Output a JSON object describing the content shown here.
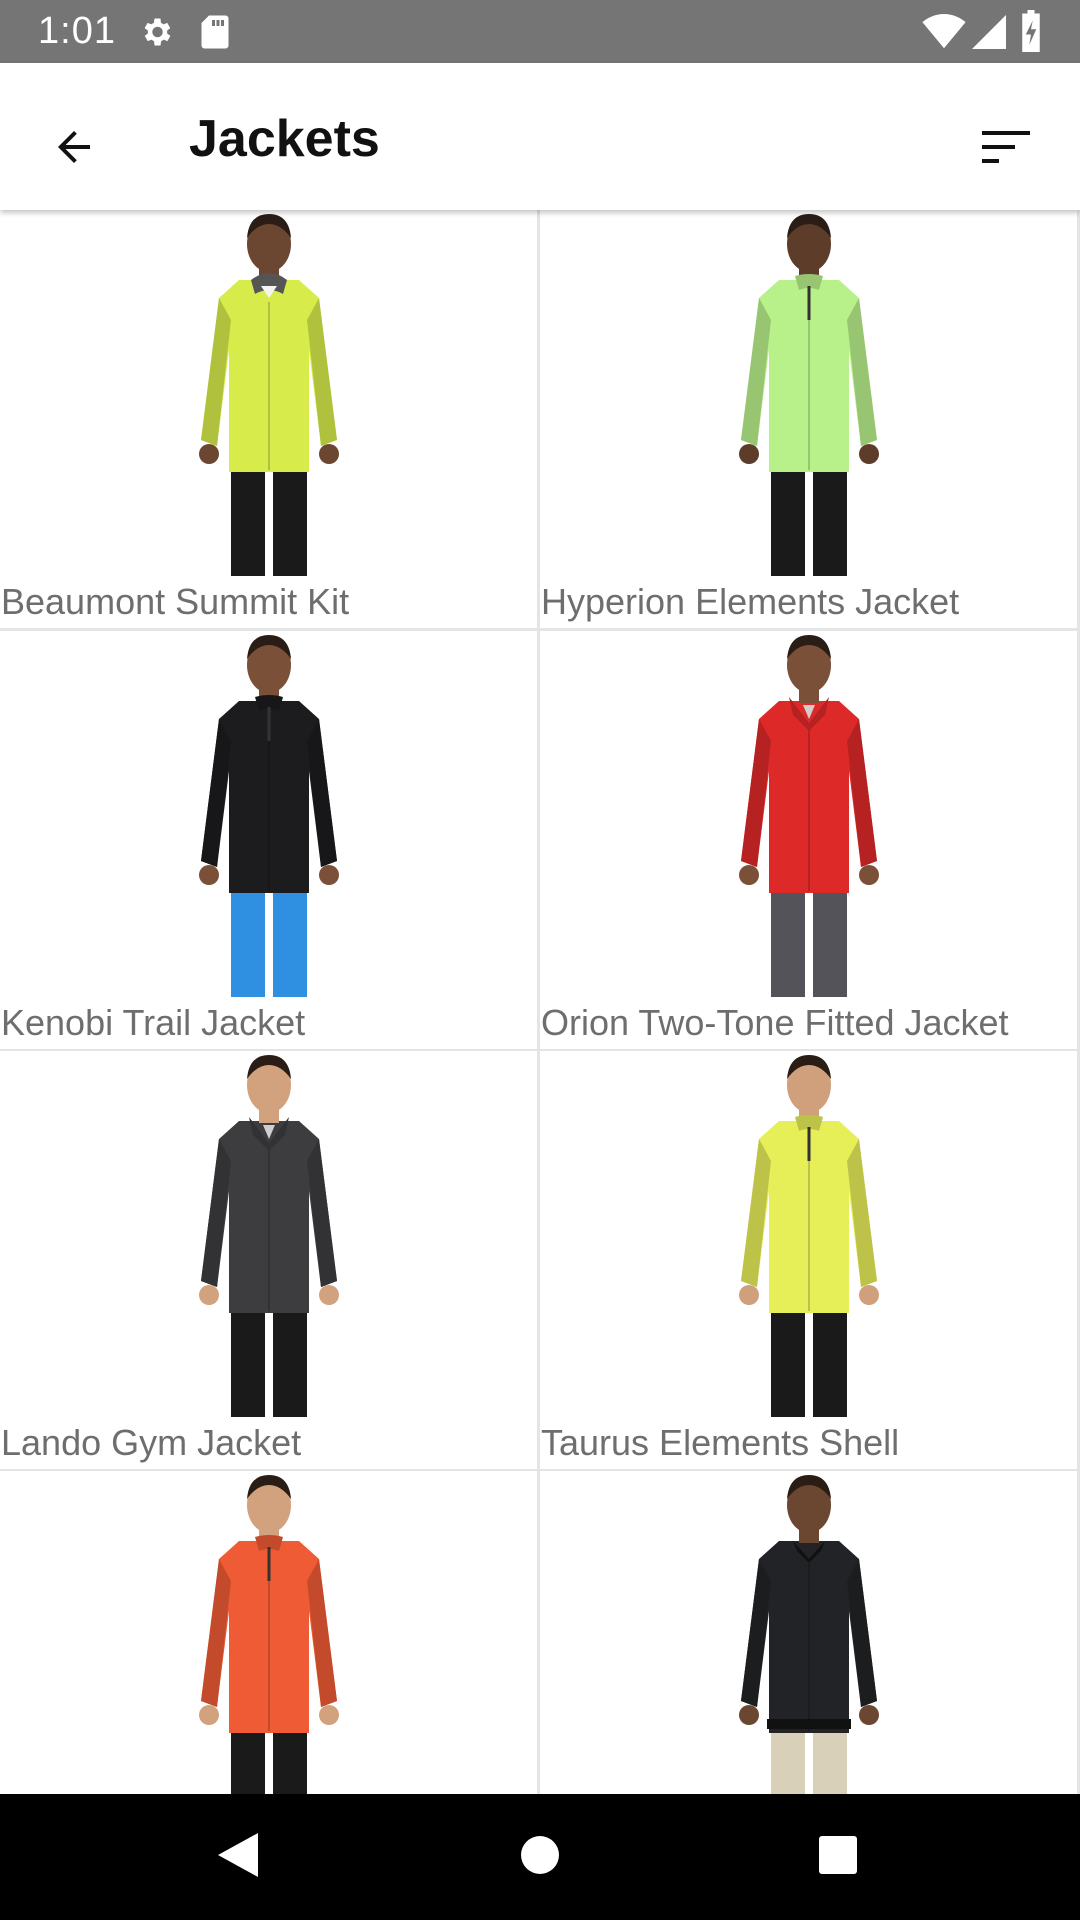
{
  "status_bar": {
    "time": "1:01",
    "icons": [
      "gear-icon",
      "sd-card-icon",
      "wifi-icon",
      "signal-icon",
      "battery-charging-icon"
    ]
  },
  "app_bar": {
    "title": "Jackets",
    "back_icon": "arrow-back-icon",
    "sort_icon": "sort-icon"
  },
  "products": [
    {
      "name": "Beaumont Summit Kit",
      "jacket_color": "#d7ec4a",
      "pants_color": "#1a1a1a",
      "skin": "#6b4631",
      "style": "hood"
    },
    {
      "name": "Hyperion Elements Jacket",
      "jacket_color": "#b8f08a",
      "pants_color": "#1a1a1a",
      "skin": "#5e3c2a",
      "style": "quarterzip"
    },
    {
      "name": "Kenobi Trail Jacket",
      "jacket_color": "#1c1c1e",
      "pants_color": "#2f8fe0",
      "skin": "#7a5038",
      "style": "quarterzip"
    },
    {
      "name": "Orion Two-Tone Fitted Jacket",
      "jacket_color": "#dd2a28",
      "pants_color": "#55535a",
      "skin": "#7a5038",
      "style": "fleece"
    },
    {
      "name": "Lando Gym Jacket",
      "jacket_color": "#3d3d3f",
      "pants_color": "#1a1a1a",
      "skin": "#d2a27e",
      "style": "fleece"
    },
    {
      "name": "Taurus Elements Shell",
      "jacket_color": "#e6ee58",
      "pants_color": "#1a1a1a",
      "skin": "#d0a07c",
      "style": "quarterzip"
    },
    {
      "name": "",
      "jacket_color": "#ee5b35",
      "pants_color": "#1a1a1a",
      "skin": "#d2a27e",
      "style": "quarterzip"
    },
    {
      "name": "",
      "jacket_color": "#222326",
      "pants_color": "#d8d0b8",
      "skin": "#6b4631",
      "style": "bomber"
    }
  ],
  "nav_bar": {
    "back_icon": "nav-back-triangle-icon",
    "home_icon": "nav-home-circle-icon",
    "recents_icon": "nav-recents-square-icon"
  }
}
